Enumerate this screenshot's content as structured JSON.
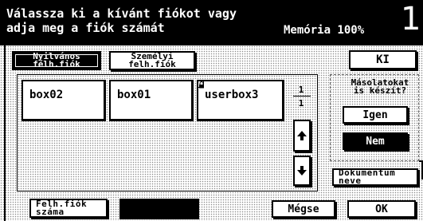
{
  "header": {
    "prompt_line1": "Válassza ki a kívánt fiókot vagy",
    "prompt_line2": "adja meg a fiók számát",
    "memory": "Memória 100%",
    "screen_number": "1"
  },
  "tabs": {
    "public_line1": "Nyilvános",
    "public_line2": "félh.fiók",
    "personal_line1": "Személyi",
    "personal_line2": "felh.fiók"
  },
  "buttons": {
    "exit": "KI",
    "yes": "Igen",
    "no": "Nem",
    "doc_name_line1": "Dokumentum",
    "doc_name_line2": "neve",
    "account_number_line1": "Felh.fiók",
    "account_number_line2": "száma",
    "cancel": "Mégse",
    "ok": "OK"
  },
  "copy_question": {
    "line1": "Másolatokat",
    "line2": "is készít?"
  },
  "boxes": [
    "box02",
    "box01",
    "userbox3"
  ],
  "pagination": {
    "current": "1",
    "total": "1"
  },
  "selected_copy_option": "Nem",
  "icons": [
    "lock-icon",
    "arrow-up-icon",
    "arrow-down-icon"
  ]
}
